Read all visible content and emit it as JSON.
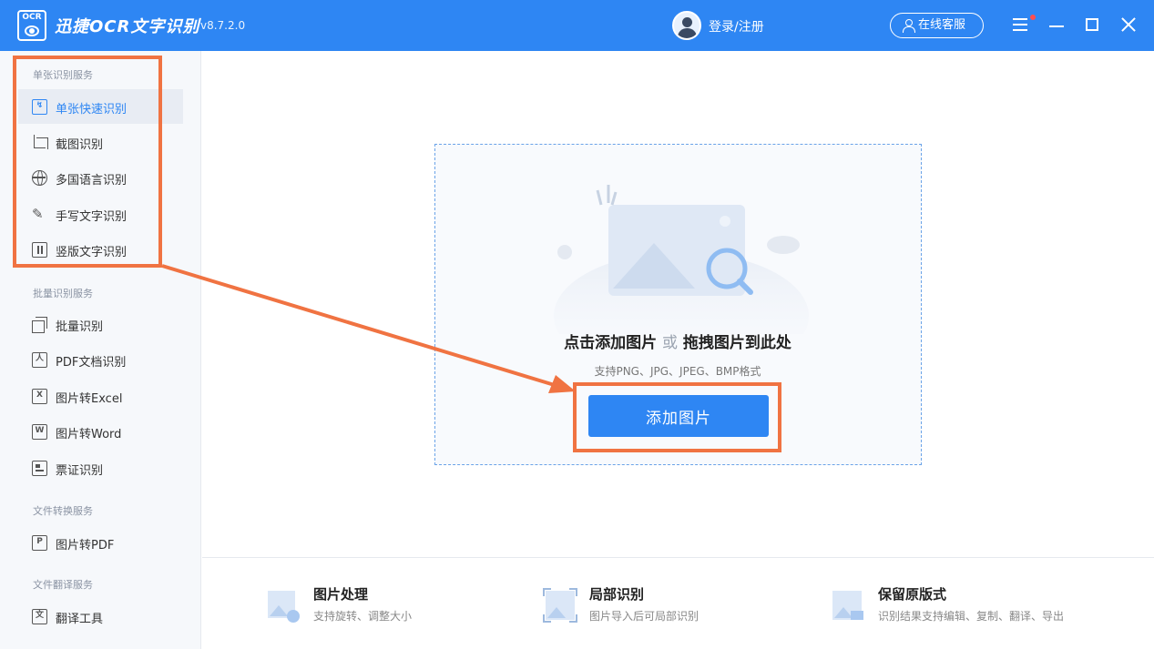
{
  "app": {
    "logo_text": "OCR",
    "title": "迅捷OCR文字识别",
    "version": "v8.7.2.0"
  },
  "header": {
    "login_label": "登录/注册",
    "service_label": "在线客服",
    "menu_icon": "hamburger-icon",
    "notification_dot_color": "#ff4d4f"
  },
  "sidebar": {
    "sections": [
      {
        "title": "单张识别服务",
        "items": [
          {
            "label": "单张快速识别",
            "icon": "quick-recognize-icon",
            "active": true
          },
          {
            "label": "截图识别",
            "icon": "crop-icon"
          },
          {
            "label": "多国语言识别",
            "icon": "globe-icon"
          },
          {
            "label": "手写文字识别",
            "icon": "pen-icon"
          },
          {
            "label": "竖版文字识别",
            "icon": "vertical-text-icon"
          }
        ]
      },
      {
        "title": "批量识别服务",
        "items": [
          {
            "label": "批量识别",
            "icon": "stack-icon"
          },
          {
            "label": "PDF文档识别",
            "icon": "pdf-icon"
          },
          {
            "label": "图片转Excel",
            "icon": "excel-icon"
          },
          {
            "label": "图片转Word",
            "icon": "word-icon"
          },
          {
            "label": "票证识别",
            "icon": "card-icon"
          }
        ]
      },
      {
        "title": "文件转换服务",
        "items": [
          {
            "label": "图片转PDF",
            "icon": "pdf-convert-icon"
          }
        ]
      },
      {
        "title": "文件翻译服务",
        "items": [
          {
            "label": "翻译工具",
            "icon": "translate-icon"
          }
        ]
      }
    ]
  },
  "upload": {
    "main_text_a": "点击添加图片",
    "main_text_or": "或",
    "main_text_b": "拖拽图片到此处",
    "formats": "支持PNG、JPG、JPEG、BMP格式",
    "button_label": "添加图片"
  },
  "features": [
    {
      "title": "图片处理",
      "desc": "支持旋转、调整大小",
      "icon": "image-process-icon"
    },
    {
      "title": "局部识别",
      "desc": "图片导入后可局部识别",
      "icon": "partial-recognize-icon"
    },
    {
      "title": "保留原版式",
      "desc": "识别结果支持编辑、复制、翻译、导出",
      "icon": "keep-layout-icon"
    }
  ],
  "colors": {
    "brand_blue": "#2e86f3",
    "annotation_orange": "#f07342"
  }
}
